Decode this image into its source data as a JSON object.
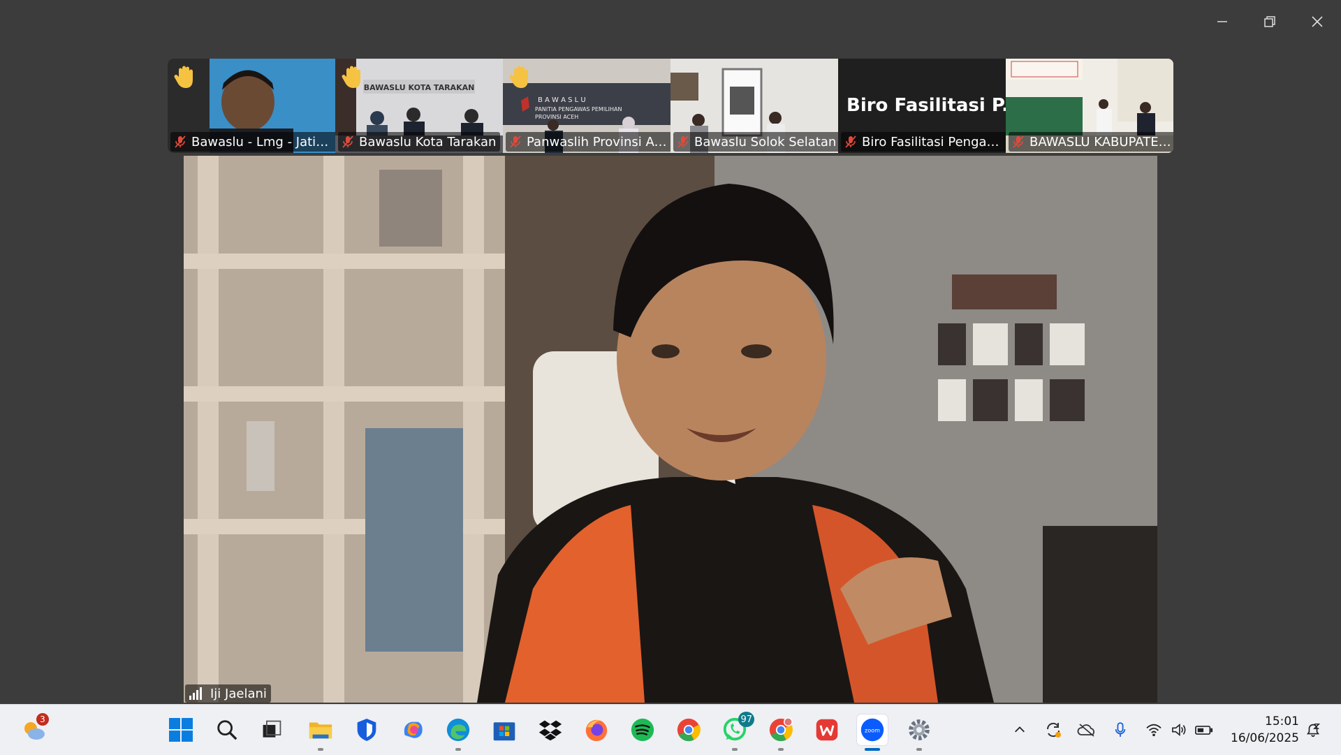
{
  "window": {
    "controls": [
      {
        "name": "minimize"
      },
      {
        "name": "restore"
      },
      {
        "name": "close"
      }
    ]
  },
  "participants": [
    {
      "label": "Bawaslu - Lmg - Jatim ...",
      "hand_raised": true,
      "muted": true
    },
    {
      "label": "Bawaslu Kota Tarakan",
      "hand_raised": true,
      "muted": true
    },
    {
      "label": "Panwaslih Provinsi Aceh",
      "hand_raised": true,
      "muted": true
    },
    {
      "label": "Bawaslu Solok Selatan",
      "hand_raised": false,
      "muted": true
    },
    {
      "label": "Biro Fasilitasi Pengawa...",
      "hand_raised": false,
      "muted": true,
      "video_off_name": "Biro Fasilitasi P..."
    },
    {
      "label": "BAWASLU KABUPATEN...",
      "hand_raised": false,
      "muted": true
    }
  ],
  "thumbnail_signage": {
    "tarakan": "BAWASLU KOTA TARAKAN",
    "aceh_line1": "B A W A S L U",
    "aceh_line2": "PANITIA PENGAWAS PEMILIHAN",
    "aceh_line3": "PROVINSI ACEH"
  },
  "active_speaker": {
    "name": "Iji Jaelani"
  },
  "taskbar": {
    "weather_badge": "3",
    "whatsapp_badge": "97",
    "zoom_label": "zoom",
    "clock_time": "15:01",
    "clock_date": "16/06/2025"
  },
  "colors": {
    "window_bg": "#3c3c3c",
    "taskbar_bg": "#eef0f4",
    "muted_mic": "#e04a3a",
    "hand": "#f5c242"
  }
}
